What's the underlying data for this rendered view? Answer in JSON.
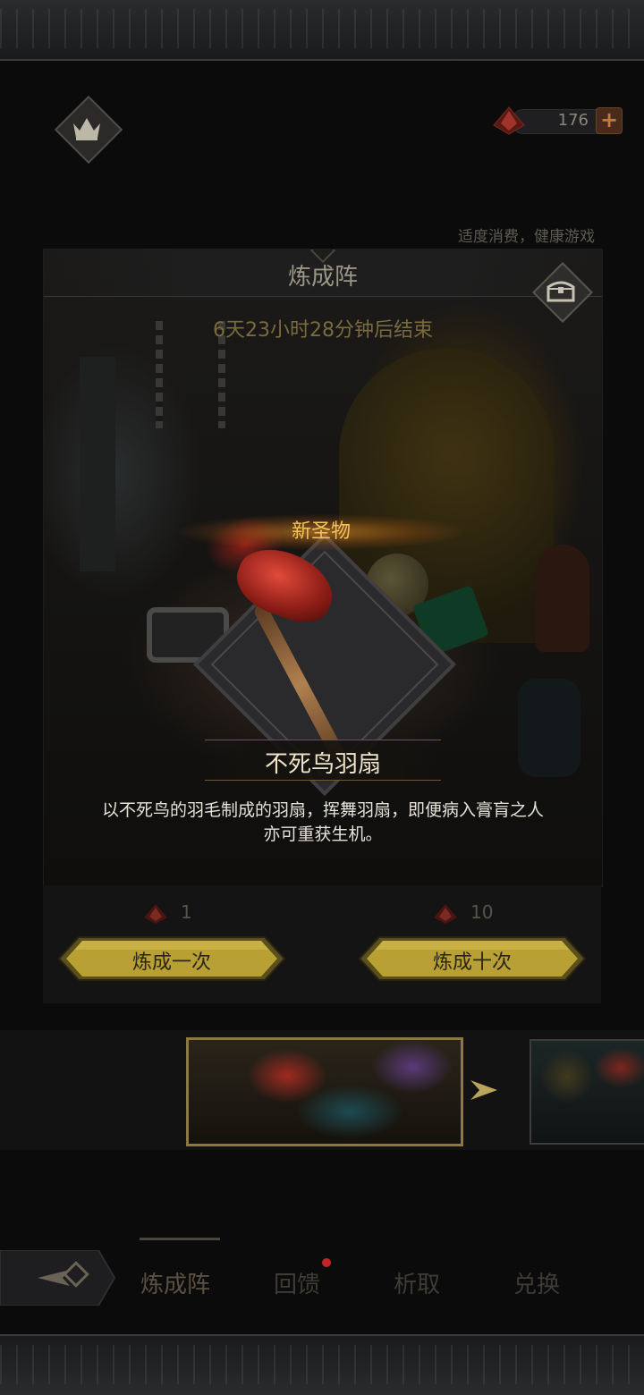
{
  "header": {
    "currency_count": "176",
    "moderation_notice": "适度消费，健康游戏"
  },
  "panel": {
    "title": "炼成阵",
    "timer": "6天23小时28分钟后结束",
    "new_label": "新圣物",
    "item_name": "不死鸟羽扇",
    "item_description": "以不死鸟的羽毛制成的羽扇，挥舞羽扇，即便病入膏肓之人亦可重获生机。"
  },
  "forge": {
    "single": {
      "cost": "1",
      "label": "炼成一次"
    },
    "ten": {
      "cost": "10",
      "label": "炼成十次"
    }
  },
  "nav": {
    "items": [
      {
        "label": "炼成阵"
      },
      {
        "label": "回馈"
      },
      {
        "label": "析取"
      },
      {
        "label": "兑换"
      }
    ]
  },
  "icons": {
    "crown": "crown-icon",
    "gem": "red-gem-icon",
    "plus": "plus-icon",
    "chest": "treasure-chest-icon",
    "arrow": "chevron-right-icon",
    "back": "back-arrow-icon"
  },
  "colors": {
    "gold_text": "#f4c25a",
    "button_gold": "#c9b13a",
    "badge_red": "#c02626"
  }
}
